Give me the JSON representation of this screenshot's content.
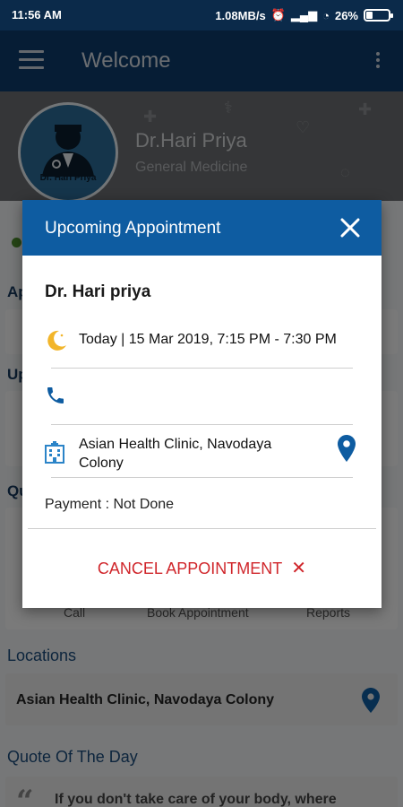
{
  "status_bar": {
    "time": "11:56 AM",
    "speed": "1.08MB/s",
    "battery": "26%"
  },
  "app_bar": {
    "title": "Welcome"
  },
  "profile": {
    "name": "Dr.Hari Priya",
    "specialty": "General Medicine",
    "avatar_caption": "Dr. Hari Priya"
  },
  "background_sections": {
    "appointments_label": "Ap",
    "upcoming_label": "Up",
    "quick_label": "Qu",
    "quick_actions": [
      "Call",
      "Book Appointment",
      "Reports"
    ]
  },
  "locations": {
    "title": "Locations",
    "items": [
      {
        "name": "Asian Health Clinic,  Navodaya Colony"
      }
    ]
  },
  "quote": {
    "title": "Quote Of The Day",
    "text": "If you don't take care of your body, where"
  },
  "dialog": {
    "title": "Upcoming Appointment",
    "doctor": "Dr. Hari priya",
    "datetime": "Today | 15 Mar 2019, 7:15 PM - 7:30 PM",
    "phone": "",
    "clinic_line1": "Asian Health Clinic,  Navodaya",
    "clinic_line2": "Colony",
    "payment": "Payment : Not Done",
    "cancel_label": "CANCEL APPOINTMENT"
  },
  "colors": {
    "header_blue": "#0e5ca1",
    "app_bar": "#0d3b6a",
    "cancel_red": "#d0262b",
    "pin_blue": "#0e5ca1"
  }
}
